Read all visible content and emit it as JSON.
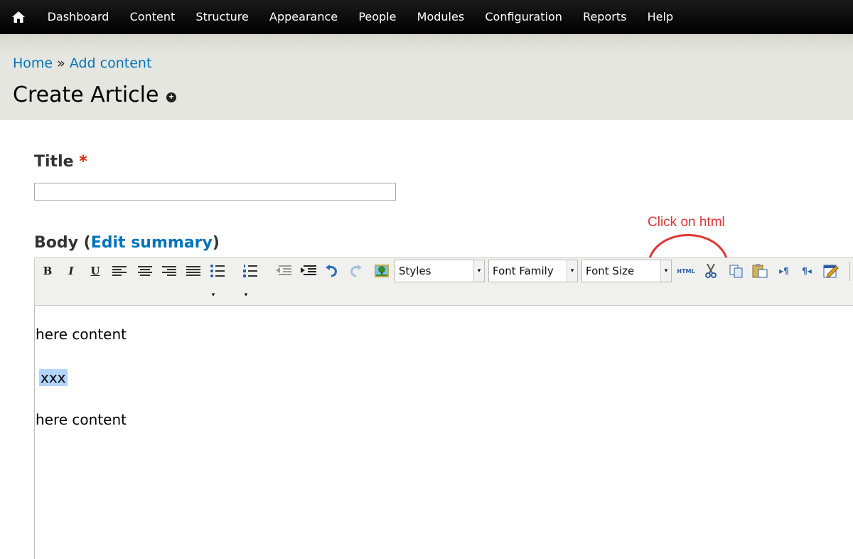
{
  "admin_toolbar": {
    "home_icon": "home-icon",
    "items": [
      {
        "label": "Dashboard"
      },
      {
        "label": "Content"
      },
      {
        "label": "Structure"
      },
      {
        "label": "Appearance"
      },
      {
        "label": "People"
      },
      {
        "label": "Modules"
      },
      {
        "label": "Configuration"
      },
      {
        "label": "Reports"
      },
      {
        "label": "Help"
      }
    ]
  },
  "breadcrumb": {
    "home": "Home",
    "separator": "»",
    "current": "Add content"
  },
  "page": {
    "title": "Create Article",
    "shortcut_icon": "add-shortcut-icon"
  },
  "form": {
    "title_label": "Title",
    "required_marker": "*",
    "title_value": "",
    "body_label": "Body",
    "body_paren_open": "(",
    "edit_summary_link": "Edit summary",
    "body_paren_close": ")"
  },
  "editor": {
    "toolbar": {
      "bold": "B",
      "italic": "I",
      "underline": "U",
      "styles_select": "Styles",
      "font_family_select": "Font Family",
      "font_size_select": "Font Size",
      "html_button": "HTML",
      "dropdown_arrow": "▾"
    },
    "content": {
      "para1": "here content",
      "selected_text": "xxx",
      "para3": "here content"
    }
  },
  "annotation": {
    "text": "Click on html",
    "color": "#e3342f"
  },
  "colors": {
    "link": "#0074bd",
    "required": "#e32700",
    "selection": "#b3d4fc"
  }
}
